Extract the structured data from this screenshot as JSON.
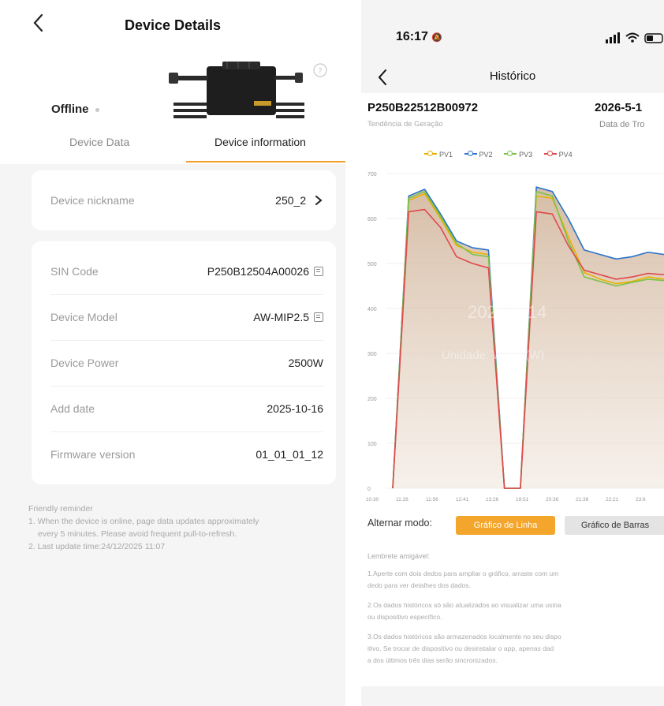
{
  "left": {
    "title": "Device Details",
    "status": "Offline",
    "tabs": [
      "Device Data",
      "Device information"
    ],
    "nickname_card": {
      "label": "Device nickname",
      "value": "250_2"
    },
    "info_rows": [
      {
        "label": "SIN Code",
        "value": "P250B12504A00026"
      },
      {
        "label": "Device Model",
        "value": "AW-MIP2.5"
      },
      {
        "label": "Device Power",
        "value": "2500W"
      },
      {
        "label": "Add date",
        "value": "2025-10-16"
      },
      {
        "label": "Firmware version",
        "value": "01_01_01_12"
      }
    ],
    "reminder": {
      "title": "Friendly reminder",
      "line1a": "1. When the device is online, page data updates approximately",
      "line1b": "every 5 minutes. Please avoid frequent pull-to-refresh.",
      "line2": "2. Last update time:24/12/2025 11:07"
    }
  },
  "right": {
    "time": "16:17",
    "title": "Histórico",
    "serial": "P250B22512B00972",
    "date": "2026-5-1",
    "subtitle_left": "Tendência de Geração",
    "subtitle_right": "Data de Tro",
    "watermark_date": "2026-5-14",
    "watermark_unit": "Unidade: Watts (W)",
    "mode_label": "Alternar modo:",
    "btn_line": "Gráfico de Linha",
    "btn_bar": "Gráfico de Barras",
    "tip_title": "Lembrete amigável:",
    "tips": [
      "1.Aperte com dois dedos para ampliar o gráfico, arraste com um",
      "  dedo para ver detalhes dos dados.",
      "2.Os dados históricos só são atualizados ao visualizar uma usina",
      "  ou dispositivo específico.",
      "3.Os dados históricos são armazenados localmente no seu dispo",
      "  itivo. Se trocar de dispositivo ou desinstalar o app, apenas dad",
      "  a dos últimos três dias serão sincronizados."
    ]
  },
  "chart_data": {
    "type": "area",
    "series": [
      {
        "name": "PV1",
        "color": "#e8b100",
        "values": [
          0,
          640,
          655,
          600,
          540,
          525,
          520,
          0,
          0,
          650,
          645,
          560,
          480,
          465,
          455,
          460,
          470,
          465
        ]
      },
      {
        "name": "PV2",
        "color": "#2a74c9",
        "values": [
          0,
          650,
          665,
          610,
          550,
          535,
          530,
          0,
          0,
          670,
          660,
          600,
          530,
          520,
          510,
          515,
          525,
          520
        ]
      },
      {
        "name": "PV3",
        "color": "#7cc24b",
        "values": [
          0,
          645,
          660,
          605,
          545,
          520,
          515,
          0,
          0,
          660,
          650,
          550,
          470,
          460,
          450,
          458,
          465,
          462
        ]
      },
      {
        "name": "PV4",
        "color": "#e0484b",
        "values": [
          0,
          615,
          620,
          580,
          515,
          500,
          490,
          0,
          0,
          615,
          610,
          540,
          485,
          475,
          465,
          470,
          478,
          475
        ]
      }
    ],
    "x_ticks": [
      "10:30",
      "11:28",
      "11:56",
      "12:41",
      "13:26",
      "19:51",
      "20:36",
      "21:36",
      "22:21",
      "23:6"
    ],
    "y_ticks": [
      0,
      100,
      200,
      300,
      400,
      500,
      600,
      700
    ],
    "ylim": [
      0,
      700
    ]
  }
}
